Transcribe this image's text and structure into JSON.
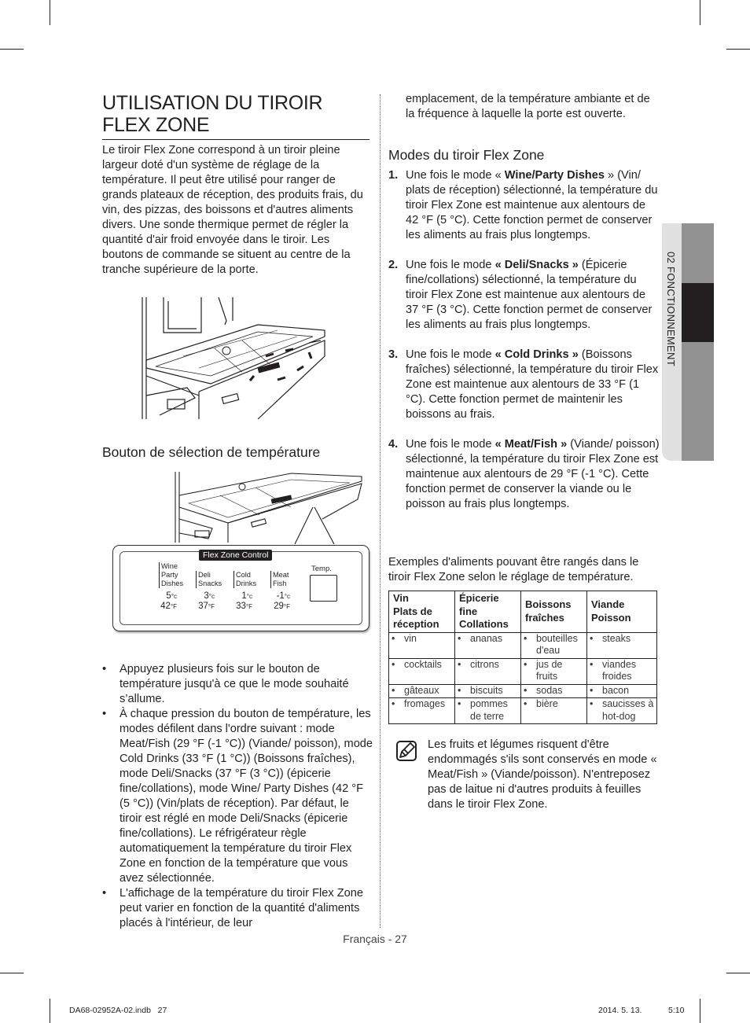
{
  "title": "UTILISATION DU TIROIR FLEX ZONE",
  "intro": "Le tiroir Flex Zone correspond à un tiroir pleine largeur doté d'un système de réglage de la température. Il peut être utilisé pour ranger de grands plateaux de réception, des produits frais, du vin, des pizzas, des boissons et d'autres aliments divers. Une sonde thermique permet de régler la quantité d'air froid envoyée dans le tiroir. Les boutons de commande se situent au centre de la tranche supérieure de la porte.",
  "temp_section": {
    "heading": "Bouton de sélection de température",
    "control_panel": {
      "title": "Flex Zone Control",
      "temp_button_label": "Temp.",
      "modes": [
        {
          "label": "Wine Party Dishes",
          "lines": [
            "Wine",
            "Party",
            "Dishes"
          ],
          "celsius": "5",
          "fahrenheit": "42"
        },
        {
          "label": "Deli Snacks",
          "lines": [
            "Deli",
            "Snacks"
          ],
          "celsius": "3",
          "fahrenheit": "37"
        },
        {
          "label": "Cold Drinks",
          "lines": [
            "Cold",
            "Drinks"
          ],
          "celsius": "1",
          "fahrenheit": "33"
        },
        {
          "label": "Meat Fish",
          "lines": [
            "Meat",
            "Fish"
          ],
          "celsius": "-1",
          "fahrenheit": "29"
        }
      ],
      "unit_c": "°c",
      "unit_f": "°F"
    },
    "bullet_glyph": "•",
    "bullets": [
      "Appuyez plusieurs fois sur le bouton de température jusqu'à ce que le mode souhaité s’allume.",
      "À chaque pression du bouton de température, les modes défilent dans l'ordre suivant : mode Meat/Fish (29 °F (-1 °C)) (Viande/ poisson), mode Cold Drinks (33 °F (1 °C)) (Boissons fraîches), mode Deli/Snacks (37 °F (3 °C)) (épicerie fine/collations), mode Wine/ Party Dishes (42 °F (5 °C)) (Vin/plats de réception). Par défaut, le tiroir est réglé en mode Deli/Snacks (épicerie fine/collations). Le réfrigérateur règle automatiquement la température du tiroir Flex Zone en fonction de la température que vous avez sélectionnée.",
      "L'affichage de la température du tiroir Flex Zone peut varier en fonction de la quantité d'aliments placés à l'intérieur, de leur"
    ]
  },
  "continuation": "emplacement, de la température ambiante et de la fréquence à laquelle la porte est ouverte.",
  "modes_section": {
    "heading": "Modes du tiroir Flex Zone",
    "items": [
      {
        "num": "1.",
        "pre": "Une fois le mode « ",
        "bold": "Wine/Party Dishes",
        "post": " » (Vin/ plats de réception) sélectionné, la température du tiroir Flex Zone est maintenue aux alentours de 42 °F (5 °C). Cette fonction permet de conserver les aliments au frais plus longtemps."
      },
      {
        "num": "2.",
        "pre": "Une fois le mode ",
        "bold": "« Deli/Snacks »",
        "post": " (Épicerie fine/collations) sélectionné, la température du tiroir Flex Zone est maintenue aux alentours de 37 °F (3 °C). Cette fonction permet de conserver les aliments au frais plus longtemps."
      },
      {
        "num": "3.",
        "pre": "Une fois le mode ",
        "bold": "« Cold Drinks »",
        "post": " (Boissons fraîches) sélectionné, la température du tiroir Flex Zone est maintenue aux alentours de 33 °F (1 °C). Cette fonction permet de maintenir les boissons au frais."
      },
      {
        "num": "4.",
        "pre": "Une fois le mode ",
        "bold": "« Meat/Fish »",
        "post": " (Viande/ poisson) sélectionné, la température du tiroir Flex Zone est maintenue aux alentours de 29 °F (-1 °C). Cette fonction permet de conserver la viande ou le poisson au frais plus longtemps."
      }
    ]
  },
  "examples_intro": "Exemples d'aliments pouvant être rangés dans le tiroir Flex Zone selon le réglage de température.",
  "food_table": {
    "headers": [
      "Vin\nPlats de\nréception",
      "Épicerie\nfine\nCollations",
      "Boissons\nfraîches",
      "Viande\nPoisson"
    ],
    "rows": [
      [
        "vin",
        "ananas",
        "bouteilles d'eau",
        "steaks"
      ],
      [
        "cocktails",
        "citrons",
        "jus de fruits",
        "viandes froides"
      ],
      [
        "gâteaux",
        "biscuits",
        "sodas",
        "bacon"
      ],
      [
        "fromages",
        "pommes de terre",
        "bière",
        "saucisses à hot-dog"
      ]
    ]
  },
  "note": {
    "icon": "note-pencil-icon",
    "text": "Les fruits et légumes risquent d'être endommagés s'ils sont conservés en mode « Meat/Fish » (Viande/poisson). N'entreposez pas de laitue ni d'autres produits à feuilles dans le tiroir Flex Zone."
  },
  "side_tab": {
    "label": "02  FONCTIONNEMENT"
  },
  "footer": {
    "page": "Français - 27",
    "file": "DA68-02952A-02.indb   27",
    "date": "2014. 5. 13.",
    "time": "5:10"
  }
}
